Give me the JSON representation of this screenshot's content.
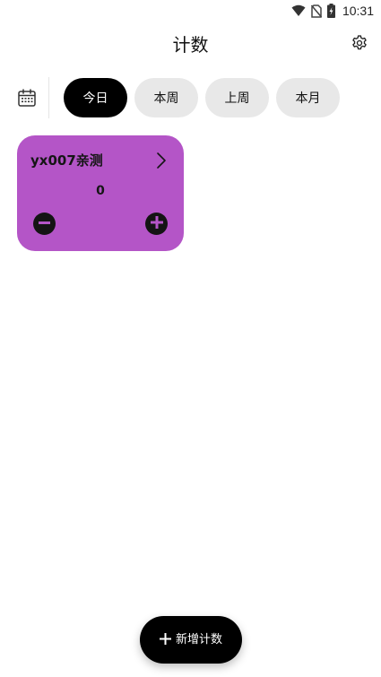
{
  "status_bar": {
    "time": "10:31",
    "icons": [
      "wifi-icon",
      "no-sim-icon",
      "battery-charging-icon"
    ]
  },
  "header": {
    "title": "计数",
    "settings_icon": "gear-icon"
  },
  "filter_bar": {
    "calendar_icon": "calendar-icon",
    "tabs": [
      {
        "label": "今日",
        "active": true
      },
      {
        "label": "本周",
        "active": false
      },
      {
        "label": "上周",
        "active": false
      },
      {
        "label": "本月",
        "active": false
      }
    ]
  },
  "counters": [
    {
      "name": "yx007亲测",
      "value": "0",
      "color": "#b455c7"
    }
  ],
  "fab": {
    "label": "新增计数",
    "icon": "plus-icon"
  },
  "colors": {
    "accent_card": "#b455c7",
    "active_tab_bg": "#000000",
    "inactive_tab_bg": "#e8e8e8"
  }
}
